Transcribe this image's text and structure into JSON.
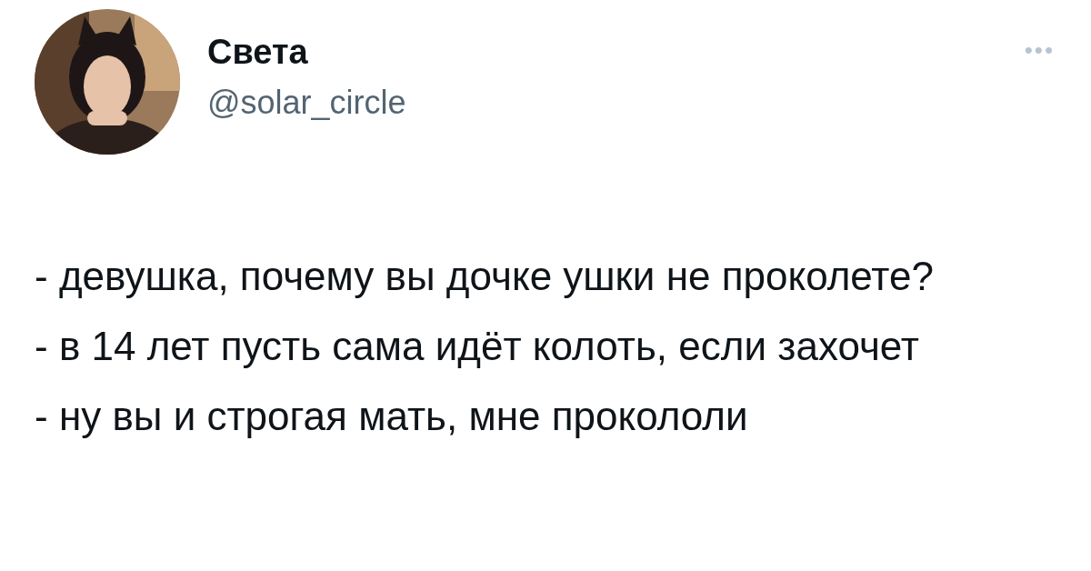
{
  "author": {
    "name": "Света",
    "handle": "@solar_circle"
  },
  "menu": {
    "label": "•••"
  },
  "lines": [
    "- девушка, почему вы дочке ушки не проколете?",
    "- в 14 лет пусть сама идёт колоть, если захочет",
    "- ну вы и строгая мать, мне прокололи"
  ]
}
